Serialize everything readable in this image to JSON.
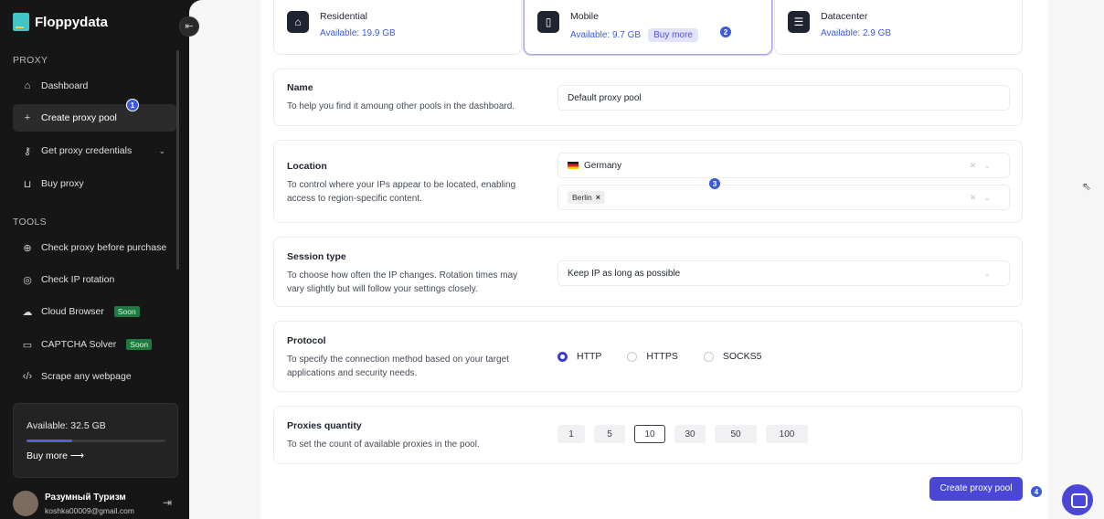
{
  "app": {
    "name": "Floppydata",
    "collapse_icon": "collapse-sidebar-icon"
  },
  "sidebar": {
    "sections": [
      {
        "label": "PROXY"
      },
      {
        "label": "TOOLS"
      }
    ],
    "items": [
      {
        "label": "Dashboard",
        "icon": "home-icon"
      },
      {
        "label": "Create proxy pool",
        "icon": "plus-icon",
        "active": true
      },
      {
        "label": "Get proxy credentials",
        "icon": "key-icon"
      },
      {
        "label": "Buy proxy",
        "icon": "cart-icon"
      },
      {
        "label": "Check proxy before purchase",
        "icon": "globe-icon"
      },
      {
        "label": "Check IP rotation",
        "icon": "rotation-icon"
      },
      {
        "label": "Cloud Browser",
        "icon": "cloud-icon",
        "badge": "Soon"
      },
      {
        "label": "CAPTCHA Solver",
        "icon": "captcha-icon",
        "badge": "Soon"
      },
      {
        "label": "Scrape any webpage",
        "icon": "code-icon"
      }
    ],
    "available": {
      "label": "Available: 32.5 GB",
      "fill_fraction": 0.33,
      "buy_more": "Buy more"
    },
    "user": {
      "name": "Разумный Туризм",
      "email": "koshka00009@gmail.com"
    }
  },
  "step_badges": [
    "1",
    "2",
    "3",
    "4"
  ],
  "pools": [
    {
      "name": "Residential",
      "available": "Available: 19.9 GB"
    },
    {
      "name": "Mobile",
      "available": "Available: 9.7 GB",
      "action": "Buy more",
      "selected": true
    },
    {
      "name": "Datacenter",
      "available": "Available: 2.9 GB"
    }
  ],
  "form": {
    "name": {
      "title": "Name",
      "desc": "To help you find it amoung other pools in the dashboard.",
      "value": "Default proxy pool"
    },
    "location": {
      "title": "Location",
      "desc": "To control where your IPs appear to be located, enabling access to region-specific content.",
      "country": "Germany",
      "city": "Berlin"
    },
    "session": {
      "title": "Session type",
      "desc": "To choose how often the IP changes. Rotation times may vary slightly but will follow your settings closely.",
      "value": "Keep IP as long as possible"
    },
    "protocol": {
      "title": "Protocol",
      "desc": "To specify the connection method based on your target applications and security needs.",
      "options": [
        "HTTP",
        "HTTPS",
        "SOCKS5"
      ],
      "selected": "HTTP"
    },
    "quantity": {
      "title": "Proxies quantity",
      "desc": "To set the count of available proxies in the pool.",
      "options": [
        "1",
        "5",
        "10",
        "30",
        "50",
        "100"
      ],
      "selected": "10"
    }
  },
  "actions": {
    "create": "Create proxy pool"
  },
  "colors": {
    "accent": "#4b47d6",
    "link": "#3b5bdb",
    "sidebar_bg": "#161616"
  }
}
